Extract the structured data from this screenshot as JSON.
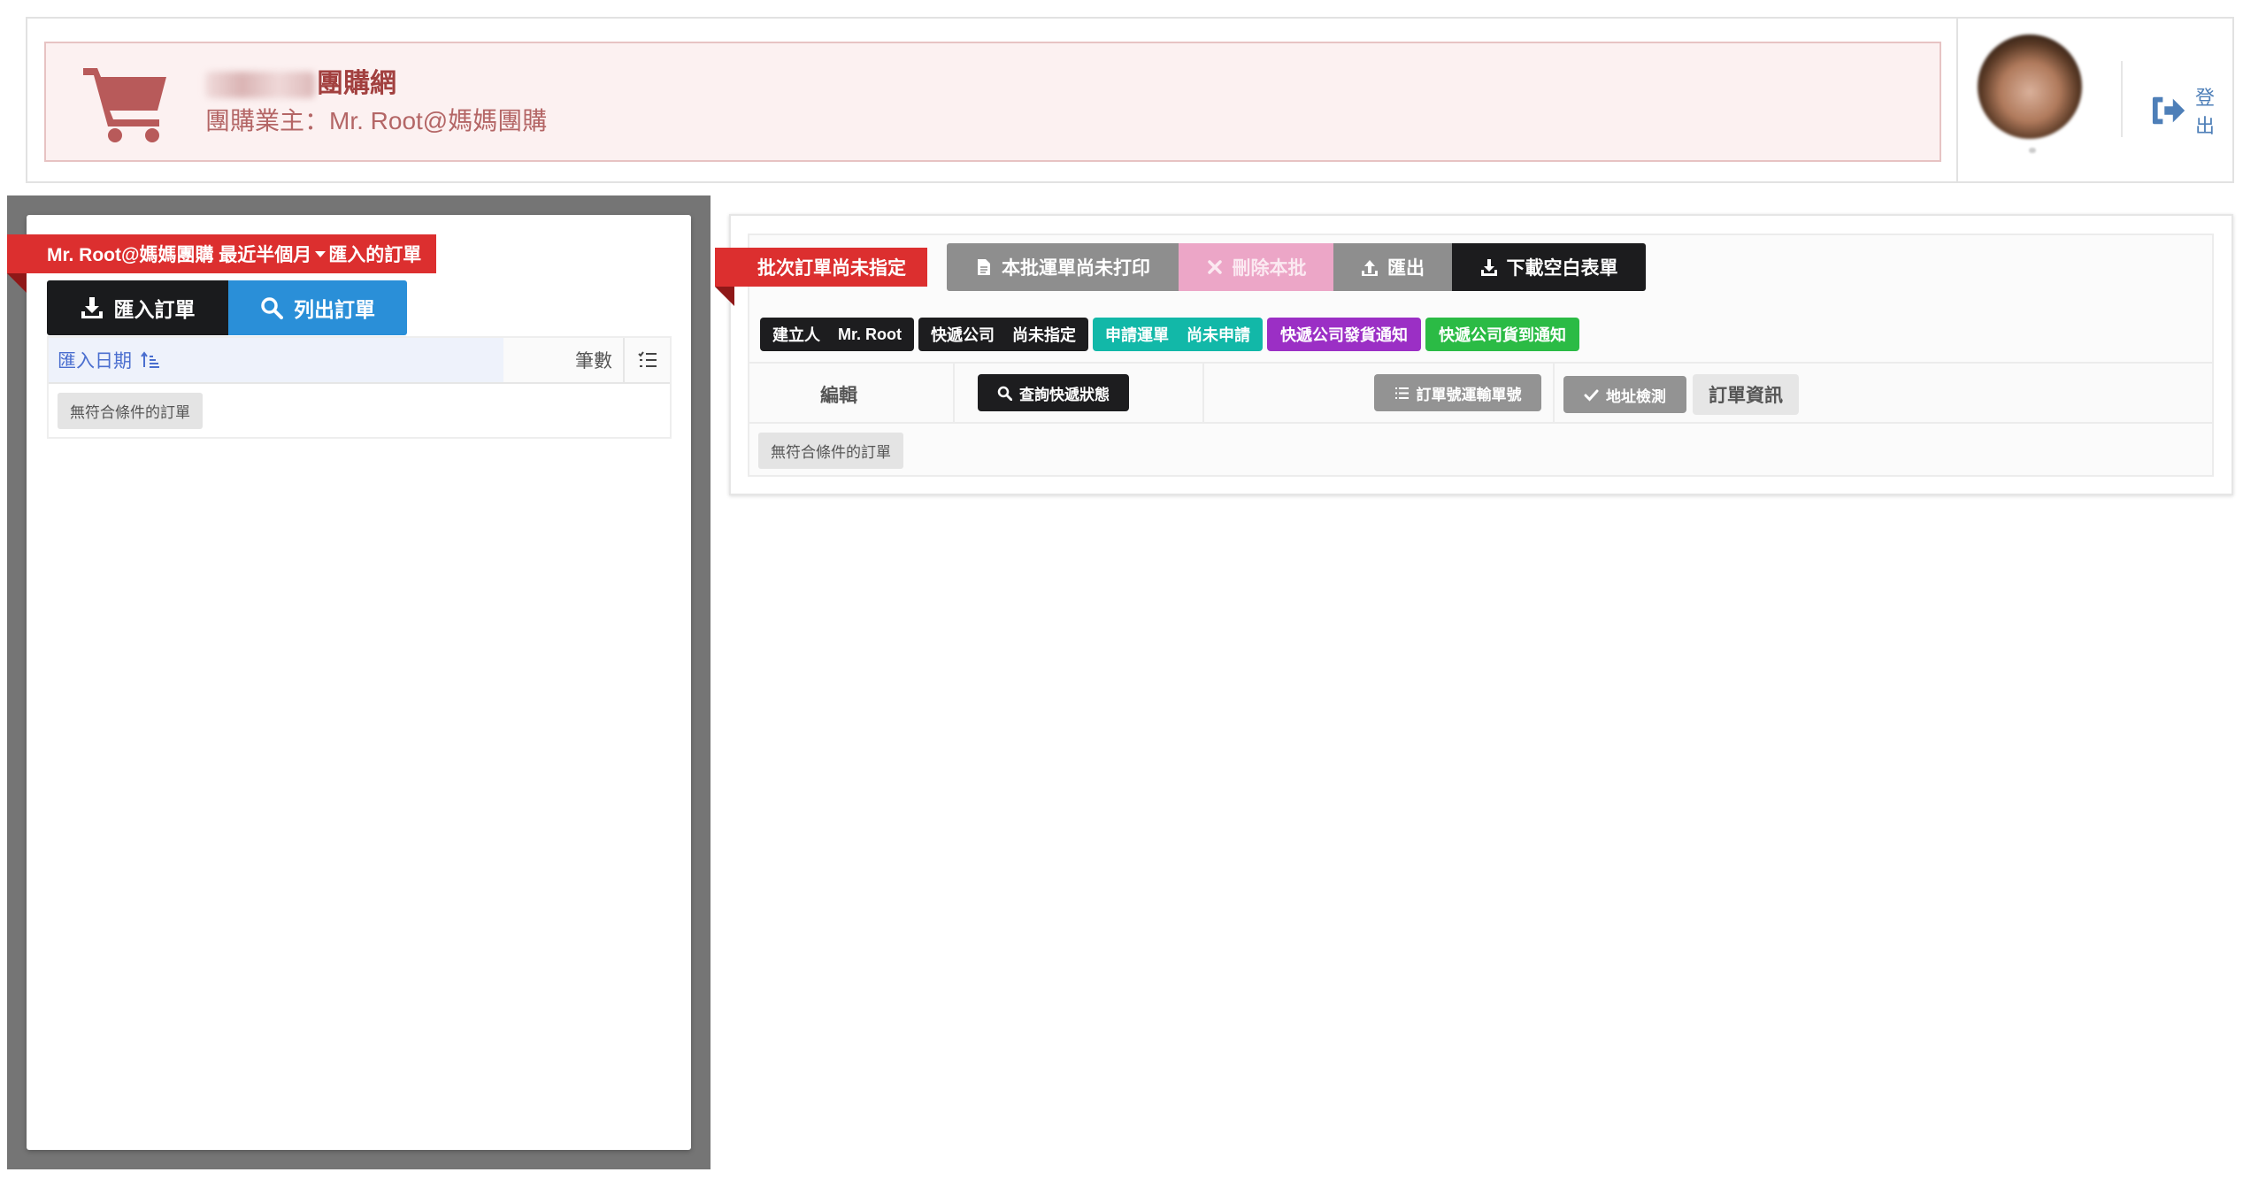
{
  "header": {
    "site_name_suffix": "團購網",
    "owner_line": "團購業主：Mr. Root@媽媽團購",
    "logout_label": "登出"
  },
  "left_panel": {
    "ribbon": {
      "prefix": "Mr. Root@媽媽團購 最近半個月",
      "suffix": "匯入的訂單"
    },
    "import_button": "匯入訂單",
    "list_button": "列出訂單",
    "table": {
      "col_date": "匯入日期",
      "col_count": "筆數",
      "empty": "無符合條件的訂單"
    }
  },
  "right_panel": {
    "ribbon": "批次訂單尚未指定",
    "toolbar": {
      "print": "本批運單尚未打印",
      "delete": "刪除本批",
      "export": "匯出",
      "download_blank": "下載空白表單"
    },
    "badges": {
      "creator_label": "建立人",
      "creator_value": "Mr. Root",
      "carrier_label": "快遞公司",
      "carrier_value": "尚未指定",
      "apply_label": "申請運單",
      "apply_value": "尚未申請",
      "ship_notice": "快遞公司發貨通知",
      "arrive_notice": "快遞公司貨到通知"
    },
    "table": {
      "col_edit": "編輯",
      "query_status": "查詢快遞狀態",
      "order_tracking": "訂單號運輸單號",
      "address_check": "地址檢測",
      "order_info": "訂單資訊",
      "empty": "無符合條件的訂單"
    }
  },
  "colors": {
    "brand_red": "#dc2f2f",
    "primary_blue": "#2a8fd8",
    "teal": "#12b8a8",
    "purple": "#9b2fc5",
    "green": "#2bbb45",
    "pink": "#eca6c7",
    "dark": "#1d1d1f",
    "gray": "#8e8e8e"
  },
  "icons": {
    "cart": "cart-icon",
    "logout": "logout-icon",
    "download": "download-icon",
    "search": "search-icon",
    "sort": "sort-ascending-icon",
    "list": "list-icon",
    "file": "file-icon",
    "delete": "x-icon",
    "upload": "upload-icon",
    "check": "check-icon"
  }
}
